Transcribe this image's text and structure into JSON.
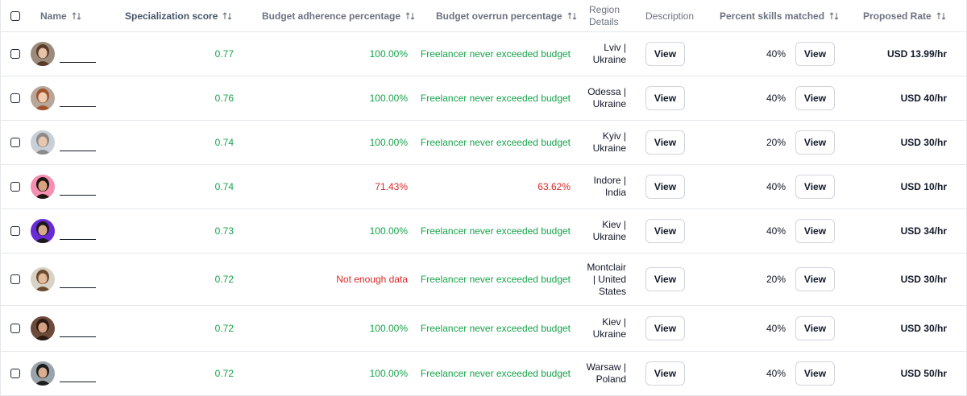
{
  "columns": {
    "name": "Name",
    "specialization": "Specialization score",
    "budget_adherence": "Budget adherence percentage",
    "budget_overrun": "Budget overrun percentage",
    "region_line1": "Region",
    "region_line2": "Details",
    "description": "Description",
    "skills": "Percent skills matched",
    "rate": "Proposed Rate"
  },
  "view_label": "View",
  "colors": {
    "green": "#16a34a",
    "red": "#dc2626",
    "border": "#e5e7eb"
  },
  "rows": [
    {
      "score": "0.77",
      "adherence": "100.00%",
      "adherence_status": "green",
      "overrun": "Freelancer never exceeded budget",
      "overrun_status": "green",
      "region": [
        "Lviv |",
        "Ukraine"
      ],
      "skills": "40%",
      "rate": "USD 13.99/hr",
      "avatar": {
        "bg": "#9b8b7d",
        "skin": "#e6c2a6",
        "hair": "#5b3b28"
      }
    },
    {
      "score": "0.76",
      "adherence": "100.00%",
      "adherence_status": "green",
      "overrun": "Freelancer never exceeded budget",
      "overrun_status": "green",
      "region": [
        "Odessa |",
        "Ukraine"
      ],
      "skills": "40%",
      "rate": "USD 40/hr",
      "avatar": {
        "bg": "#b7a79a",
        "skin": "#efcdb2",
        "hair": "#a0522d"
      }
    },
    {
      "score": "0.74",
      "adherence": "100.00%",
      "adherence_status": "green",
      "overrun": "Freelancer never exceeded budget",
      "overrun_status": "green",
      "region": [
        "Kyiv |",
        "Ukraine"
      ],
      "skills": "20%",
      "rate": "USD 30/hr",
      "avatar": {
        "bg": "#c9cfd6",
        "skin": "#e8c7ae",
        "hair": "#8a8a8a"
      }
    },
    {
      "score": "0.74",
      "adherence": "71.43%",
      "adherence_status": "red",
      "overrun": "63.62%",
      "overrun_status": "red",
      "region": [
        "Indore |",
        "India"
      ],
      "skills": "40%",
      "rate": "USD 10/hr",
      "avatar": {
        "bg": "#f48fb1",
        "skin": "#d9a37f",
        "hair": "#1f1410"
      }
    },
    {
      "score": "0.73",
      "adherence": "100.00%",
      "adherence_status": "green",
      "overrun": "Freelancer never exceeded budget",
      "overrun_status": "green",
      "region": [
        "Kiev |",
        "Ukraine"
      ],
      "skills": "40%",
      "rate": "USD 34/hr",
      "avatar": {
        "bg": "#6a2ad8",
        "skin": "#d8a88a",
        "hair": "#1a1a1a"
      }
    },
    {
      "score": "0.72",
      "adherence": "Not enough data",
      "adherence_status": "red",
      "overrun": "Freelancer never exceeded budget",
      "overrun_status": "green",
      "region": [
        "Montclair",
        "| United",
        "States"
      ],
      "skills": "20%",
      "rate": "USD 30/hr",
      "avatar": {
        "bg": "#d8d2c6",
        "skin": "#e2b99a",
        "hair": "#6b4b2f"
      }
    },
    {
      "score": "0.72",
      "adherence": "100.00%",
      "adherence_status": "green",
      "overrun": "Freelancer never exceeded budget",
      "overrun_status": "green",
      "region": [
        "Kiev |",
        "Ukraine"
      ],
      "skills": "40%",
      "rate": "USD 30/hr",
      "avatar": {
        "bg": "#6b4a3a",
        "skin": "#d5a182",
        "hair": "#2a1a12"
      }
    },
    {
      "score": "0.72",
      "adherence": "100.00%",
      "adherence_status": "green",
      "overrun": "Freelancer never exceeded budget",
      "overrun_status": "green",
      "region": [
        "Warsaw |",
        "Poland"
      ],
      "skills": "40%",
      "rate": "USD 50/hr",
      "avatar": {
        "bg": "#9aa3aa",
        "skin": "#d9ad90",
        "hair": "#1c1c1c"
      }
    }
  ]
}
